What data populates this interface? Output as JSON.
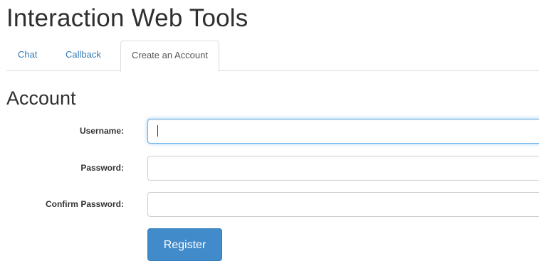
{
  "header": {
    "title": "Interaction Web Tools"
  },
  "tabs": [
    {
      "label": "Chat",
      "active": false
    },
    {
      "label": "Callback",
      "active": false
    },
    {
      "label": "Create an Account",
      "active": true
    }
  ],
  "account_form": {
    "section_title": "Account",
    "fields": [
      {
        "label": "Username:",
        "value": "",
        "focused": true
      },
      {
        "label": "Password:",
        "value": ""
      },
      {
        "label": "Confirm Password:",
        "value": ""
      }
    ],
    "register_label": "Register"
  },
  "colors": {
    "link": "#337ab7",
    "primary_button": "#428bca",
    "focus_border": "#66afe9"
  }
}
